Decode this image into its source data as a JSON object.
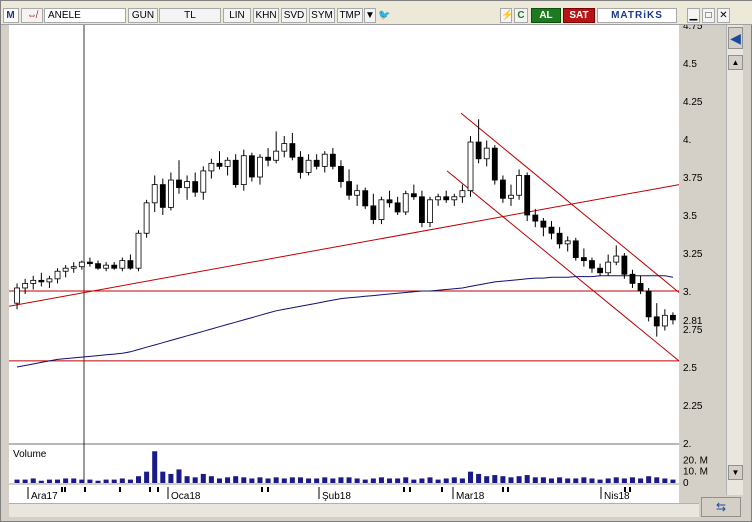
{
  "toolbar": {
    "logo_m": "M",
    "symbol": "ANELE",
    "period": "GUN",
    "currency": "TL",
    "scale": "LIN",
    "buttons": [
      "KHN",
      "SVD",
      "SYM",
      "TMP"
    ],
    "refresh_label": "C",
    "buy_label": "AL",
    "sell_label": "SAT",
    "brand": "MATRiKS",
    "brand_color": "#1a3a8a",
    "buy_color": "#1e7a1e",
    "sell_color": "#b81414"
  },
  "chart_data": {
    "type": "candlestick",
    "symbol": "ANELE",
    "y_ticks": [
      "4.75",
      "4.5",
      "4.25",
      "4.",
      "3.75",
      "3.5",
      "3.25",
      "3.",
      "2.75",
      "2.5",
      "2.25",
      "2."
    ],
    "y_range": [
      2.0,
      4.75
    ],
    "last_price_label": "2.81",
    "x_labels": [
      "Ara17",
      "Oca18",
      "Şub18",
      "Mar18",
      "Nis18"
    ],
    "candles": [
      [
        2.92,
        3.05,
        2.88,
        3.02
      ],
      [
        3.02,
        3.08,
        2.98,
        3.05
      ],
      [
        3.05,
        3.1,
        3.01,
        3.07
      ],
      [
        3.07,
        3.12,
        3.03,
        3.06
      ],
      [
        3.06,
        3.1,
        3.02,
        3.08
      ],
      [
        3.08,
        3.15,
        3.05,
        3.13
      ],
      [
        3.13,
        3.17,
        3.09,
        3.15
      ],
      [
        3.15,
        3.19,
        3.12,
        3.16
      ],
      [
        3.16,
        3.2,
        3.14,
        3.19
      ],
      [
        3.19,
        3.22,
        3.16,
        3.18
      ],
      [
        3.18,
        3.2,
        3.14,
        3.15
      ],
      [
        3.15,
        3.19,
        3.13,
        3.17
      ],
      [
        3.17,
        3.19,
        3.14,
        3.15
      ],
      [
        3.15,
        3.22,
        3.13,
        3.2
      ],
      [
        3.2,
        3.24,
        3.14,
        3.15
      ],
      [
        3.15,
        3.4,
        3.13,
        3.38
      ],
      [
        3.38,
        3.6,
        3.35,
        3.58
      ],
      [
        3.58,
        3.76,
        3.52,
        3.7
      ],
      [
        3.7,
        3.74,
        3.5,
        3.55
      ],
      [
        3.55,
        3.78,
        3.53,
        3.73
      ],
      [
        3.73,
        3.86,
        3.64,
        3.68
      ],
      [
        3.68,
        3.76,
        3.6,
        3.72
      ],
      [
        3.72,
        3.78,
        3.62,
        3.65
      ],
      [
        3.65,
        3.82,
        3.6,
        3.79
      ],
      [
        3.79,
        3.87,
        3.74,
        3.84
      ],
      [
        3.84,
        3.92,
        3.8,
        3.82
      ],
      [
        3.82,
        3.88,
        3.76,
        3.86
      ],
      [
        3.86,
        3.9,
        3.68,
        3.7
      ],
      [
        3.7,
        3.93,
        3.66,
        3.89
      ],
      [
        3.89,
        3.91,
        3.72,
        3.75
      ],
      [
        3.75,
        3.9,
        3.7,
        3.88
      ],
      [
        3.88,
        3.94,
        3.82,
        3.86
      ],
      [
        3.86,
        4.05,
        3.84,
        3.92
      ],
      [
        3.92,
        4.02,
        3.88,
        3.97
      ],
      [
        3.97,
        4.04,
        3.86,
        3.88
      ],
      [
        3.88,
        3.92,
        3.74,
        3.78
      ],
      [
        3.78,
        3.9,
        3.76,
        3.86
      ],
      [
        3.86,
        3.9,
        3.8,
        3.82
      ],
      [
        3.82,
        3.92,
        3.78,
        3.9
      ],
      [
        3.9,
        3.94,
        3.8,
        3.82
      ],
      [
        3.82,
        3.86,
        3.68,
        3.72
      ],
      [
        3.72,
        3.8,
        3.6,
        3.63
      ],
      [
        3.63,
        3.7,
        3.56,
        3.66
      ],
      [
        3.66,
        3.68,
        3.54,
        3.56
      ],
      [
        3.56,
        3.64,
        3.44,
        3.47
      ],
      [
        3.47,
        3.62,
        3.44,
        3.6
      ],
      [
        3.6,
        3.66,
        3.55,
        3.58
      ],
      [
        3.58,
        3.62,
        3.5,
        3.52
      ],
      [
        3.52,
        3.66,
        3.5,
        3.64
      ],
      [
        3.64,
        3.7,
        3.6,
        3.62
      ],
      [
        3.62,
        3.66,
        3.42,
        3.45
      ],
      [
        3.45,
        3.62,
        3.42,
        3.6
      ],
      [
        3.6,
        3.64,
        3.56,
        3.62
      ],
      [
        3.62,
        3.66,
        3.58,
        3.6
      ],
      [
        3.6,
        3.64,
        3.56,
        3.62
      ],
      [
        3.62,
        3.7,
        3.58,
        3.66
      ],
      [
        3.66,
        4.02,
        3.62,
        3.98
      ],
      [
        3.98,
        4.13,
        3.84,
        3.87
      ],
      [
        3.87,
        3.99,
        3.82,
        3.94
      ],
      [
        3.94,
        3.96,
        3.7,
        3.73
      ],
      [
        3.73,
        3.76,
        3.58,
        3.61
      ],
      [
        3.61,
        3.7,
        3.56,
        3.63
      ],
      [
        3.63,
        3.8,
        3.6,
        3.76
      ],
      [
        3.76,
        3.78,
        3.46,
        3.5
      ],
      [
        3.5,
        3.54,
        3.42,
        3.46
      ],
      [
        3.46,
        3.48,
        3.36,
        3.42
      ],
      [
        3.42,
        3.46,
        3.34,
        3.38
      ],
      [
        3.38,
        3.42,
        3.28,
        3.31
      ],
      [
        3.31,
        3.36,
        3.26,
        3.33
      ],
      [
        3.33,
        3.35,
        3.2,
        3.22
      ],
      [
        3.22,
        3.28,
        3.16,
        3.2
      ],
      [
        3.2,
        3.22,
        3.12,
        3.15
      ],
      [
        3.15,
        3.18,
        3.1,
        3.12
      ],
      [
        3.12,
        3.24,
        3.1,
        3.19
      ],
      [
        3.19,
        3.3,
        3.17,
        3.23
      ],
      [
        3.23,
        3.25,
        3.08,
        3.11
      ],
      [
        3.11,
        3.14,
        3.02,
        3.05
      ],
      [
        3.05,
        3.1,
        2.98,
        3.0
      ],
      [
        3.0,
        3.02,
        2.8,
        2.83
      ],
      [
        2.83,
        2.92,
        2.7,
        2.77
      ],
      [
        2.77,
        2.88,
        2.74,
        2.84
      ],
      [
        2.84,
        2.86,
        2.78,
        2.81
      ]
    ],
    "ma": [
      2.5,
      2.51,
      2.52,
      2.53,
      2.54,
      2.55,
      2.555,
      2.56,
      2.565,
      2.57,
      2.575,
      2.58,
      2.585,
      2.59,
      2.6,
      2.615,
      2.63,
      2.645,
      2.66,
      2.675,
      2.69,
      2.705,
      2.72,
      2.735,
      2.75,
      2.765,
      2.78,
      2.795,
      2.81,
      2.825,
      2.84,
      2.855,
      2.87,
      2.88,
      2.89,
      2.9,
      2.91,
      2.92,
      2.93,
      2.94,
      2.95,
      2.955,
      2.96,
      2.965,
      2.97,
      2.975,
      2.98,
      2.985,
      2.99,
      2.995,
      3.0,
      3.0,
      3.005,
      3.01,
      3.015,
      3.02,
      3.03,
      3.04,
      3.05,
      3.06,
      3.065,
      3.07,
      3.075,
      3.08,
      3.085,
      3.085,
      3.09,
      3.09,
      3.09,
      3.095,
      3.095,
      3.095,
      3.1,
      3.1,
      3.1,
      3.1,
      3.1,
      3.1,
      3.1,
      3.1,
      3.1,
      3.09
    ],
    "volume": {
      "label": "Volume",
      "ticks": [
        "20. M",
        "10. M",
        "0"
      ],
      "values": [
        3,
        3,
        4,
        2,
        3,
        3,
        4,
        4,
        3,
        3,
        2,
        3,
        3,
        4,
        3,
        6,
        10,
        28,
        10,
        8,
        12,
        6,
        5,
        8,
        6,
        4,
        5,
        6,
        5,
        4,
        5,
        4,
        5,
        4,
        5,
        5,
        4,
        4,
        5,
        4,
        5,
        5,
        4,
        3,
        4,
        5,
        4,
        4,
        5,
        3,
        4,
        5,
        3,
        4,
        5,
        4,
        10,
        8,
        6,
        7,
        6,
        5,
        6,
        7,
        5,
        5,
        4,
        5,
        4,
        4,
        5,
        4,
        3,
        4,
        5,
        4,
        5,
        4,
        6,
        5,
        4,
        3
      ]
    }
  }
}
